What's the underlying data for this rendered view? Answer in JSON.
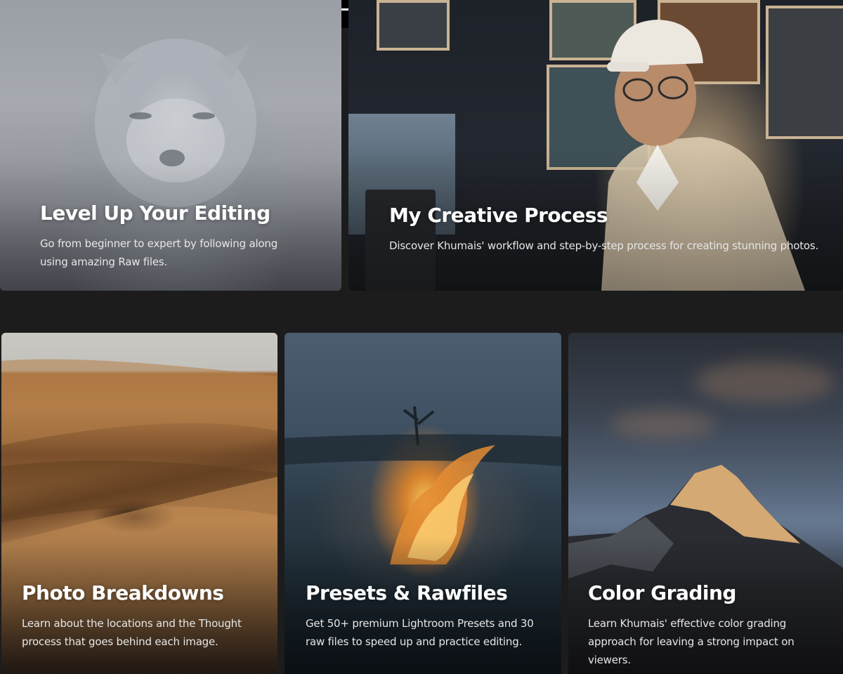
{
  "cards": [
    {
      "title": "Level Up Your Editing",
      "description": "Go from beginner to expert by following along using amazing Raw files."
    },
    {
      "title": "My Creative Process",
      "description": "Discover Khumais' workflow and step-by-step process for creating stunning photos."
    },
    {
      "title": "Photo Breakdowns",
      "description": "Learn about the locations and the Thought process that goes behind each image."
    },
    {
      "title": "Presets & Rawfiles",
      "description": "Get 50+ premium Lightroom Presets and 30 raw files to speed up and practice editing."
    },
    {
      "title": "Color Grading",
      "description": "Learn Khumais' effective color grading approach for leaving a strong impact on viewers."
    }
  ],
  "colors": {
    "page_background": "#1c1c1d",
    "title_text": "#ffffff",
    "body_text": "#e6e6e6"
  }
}
